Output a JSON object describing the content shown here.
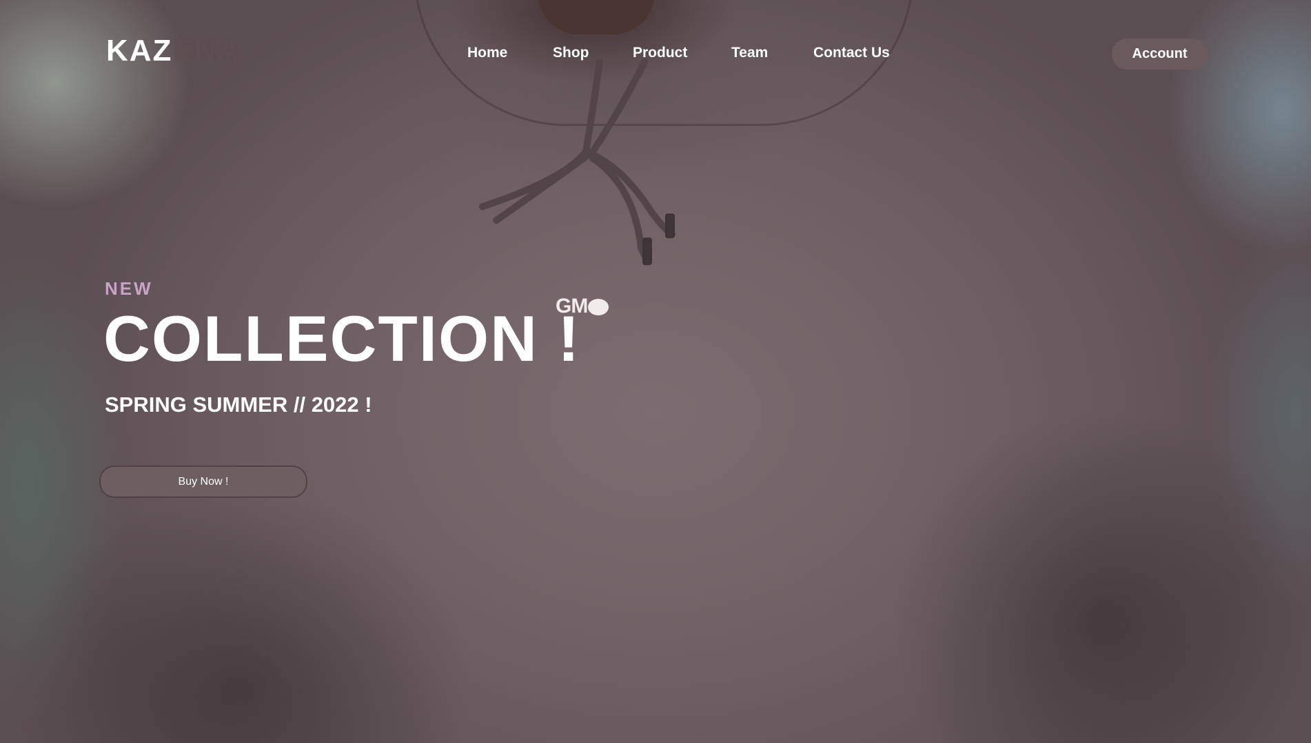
{
  "brand": {
    "logo_primary": "KAZ",
    "logo_secondary": "ENA",
    "colors": {
      "logo_primary": "#ffffff",
      "logo_secondary": "#5e4f53",
      "accent_pink": "#c8a3c5",
      "button_bg": "#6a5a5e"
    }
  },
  "nav": {
    "items": [
      {
        "label": "Home"
      },
      {
        "label": "Shop"
      },
      {
        "label": "Product"
      },
      {
        "label": "Team"
      },
      {
        "label": "Contact Us"
      }
    ],
    "account_label": "Account"
  },
  "hero": {
    "eyebrow": "NEW",
    "headline": "COLLECTION !",
    "subheadline": "SPRING SUMMER // 2022 !",
    "cta_label": "Buy Now !",
    "garment_print": "GM"
  }
}
